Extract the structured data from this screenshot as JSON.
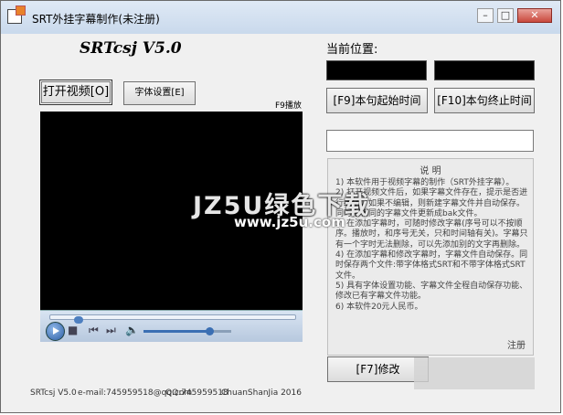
{
  "window": {
    "title": "SRT外挂字幕制作(未注册)",
    "controls": {
      "minimize": "–",
      "maximize": "□",
      "close": "✕"
    }
  },
  "app": {
    "name": "SRTcsj V5.0"
  },
  "buttons": {
    "open_video": "打开视频[O]",
    "font_settings": "字体设置[E]",
    "start_time": "[F9]本句起始时间",
    "end_time": "[F10]本句终止时间",
    "modify": "[F7]修改"
  },
  "labels": {
    "current_position": "当前位置:",
    "f9_play": "F9播放"
  },
  "player": {
    "progress": 0.1,
    "volume": 0.75
  },
  "info": {
    "title": "说  明",
    "lines": [
      "1) 本软件用于视频字幕的制作（SRT外挂字幕）。",
      "2) 打开视频文件后，如果字幕文件存在，提示是否进行编辑。如果不编辑，则新建字幕文件并自动保存。同时把相同的字幕文件更新成bak文件。",
      "3) 在添加字幕时，可随时修改字幕(序号可以不按顺序。播放时，和序号无关，只和时间轴有关)。字幕只有一个字时无法删除，可以先添加别的文字再删除。",
      "4) 在添加字幕和修改字幕时，字幕文件自动保存。同时保存两个文件:带字体格式SRT和不带字体格式SRT文件。",
      "5) 具有字体设置功能、字幕文件全程自动保存功能、修改已有字幕文件功能。",
      "6) 本软件20元人民币。"
    ],
    "register": "注册"
  },
  "watermark": {
    "main": "JZ5U绿色下载",
    "url": "www.jz5u.com"
  },
  "footer": {
    "version": "SRTcsj V5.0",
    "email": "e-mail:745959518@qq.com",
    "qq": "QQ:745959518",
    "author": "ChuanShanJia 2016"
  }
}
